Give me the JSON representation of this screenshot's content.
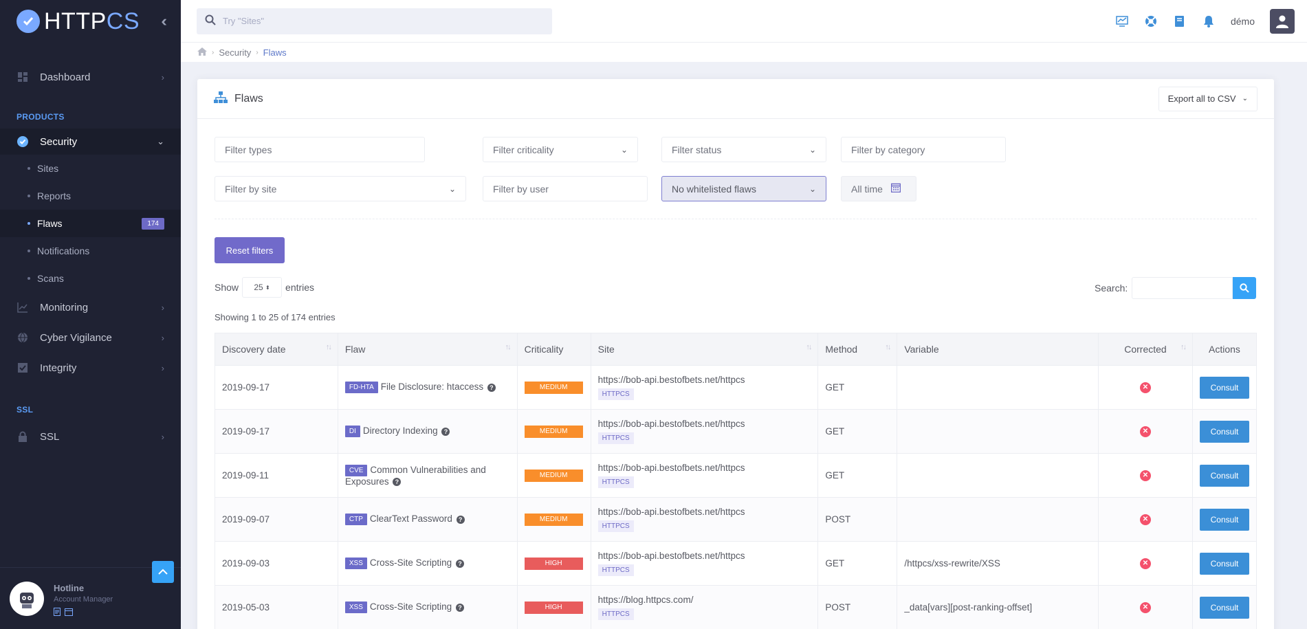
{
  "brand": {
    "name_part1": "HTTP",
    "name_part2": "CS"
  },
  "sidebar": {
    "dashboard": "Dashboard",
    "section_products": "PRODUCTS",
    "security": "Security",
    "sub": [
      {
        "label": "Sites"
      },
      {
        "label": "Reports"
      },
      {
        "label": "Flaws",
        "badge": "174"
      },
      {
        "label": "Notifications"
      },
      {
        "label": "Scans"
      }
    ],
    "monitoring": "Monitoring",
    "cyber_vigilance": "Cyber Vigilance",
    "integrity": "Integrity",
    "section_ssl": "SSL",
    "ssl": "SSL",
    "hotline": "Hotline",
    "account_manager": "Account Manager"
  },
  "header": {
    "search_placeholder": "Try \"Sites\"",
    "username": "démo"
  },
  "breadcrumb": {
    "security": "Security",
    "flaws": "Flaws"
  },
  "card": {
    "title": "Flaws",
    "export": "Export all to CSV"
  },
  "filters": {
    "types": "Filter types",
    "criticality": "Filter criticality",
    "status": "Filter status",
    "category": "Filter by category",
    "site": "Filter by site",
    "user": "Filter by user",
    "whitelist": "No whitelisted flaws",
    "date": "All time",
    "reset": "Reset filters"
  },
  "table_controls": {
    "show": "Show",
    "length": "25",
    "entries": "entries",
    "search_label": "Search:",
    "showing": "Showing 1 to 25 of 174 entries"
  },
  "columns": [
    "Discovery date",
    "Flaw",
    "Criticality",
    "Site",
    "Method",
    "Variable",
    "Corrected",
    "Actions"
  ],
  "rows": [
    {
      "date": "2019-09-17",
      "code": "FD-HTA",
      "flaw": "File Disclosure: htaccess",
      "criticality": "MEDIUM",
      "site": "https://bob-api.bestofbets.net/httpcs",
      "tag": "HTTPCS",
      "method": "GET",
      "variable": "",
      "action": "Consult"
    },
    {
      "date": "2019-09-17",
      "code": "DI",
      "flaw": "Directory Indexing",
      "criticality": "MEDIUM",
      "site": "https://bob-api.bestofbets.net/httpcs",
      "tag": "HTTPCS",
      "method": "GET",
      "variable": "",
      "action": "Consult"
    },
    {
      "date": "2019-09-11",
      "code": "CVE",
      "flaw": "Common Vulnerabilities and Exposures",
      "criticality": "MEDIUM",
      "site": "https://bob-api.bestofbets.net/httpcs",
      "tag": "HTTPCS",
      "method": "GET",
      "variable": "",
      "action": "Consult"
    },
    {
      "date": "2019-09-07",
      "code": "CTP",
      "flaw": "ClearText Password",
      "criticality": "MEDIUM",
      "site": "https://bob-api.bestofbets.net/httpcs",
      "tag": "HTTPCS",
      "method": "POST",
      "variable": "",
      "action": "Consult"
    },
    {
      "date": "2019-09-03",
      "code": "XSS",
      "flaw": "Cross-Site Scripting",
      "criticality": "HIGH",
      "site": "https://bob-api.bestofbets.net/httpcs",
      "tag": "HTTPCS",
      "method": "GET",
      "variable": "/httpcs/xss-rewrite/XSS",
      "action": "Consult"
    },
    {
      "date": "2019-05-03",
      "code": "XSS",
      "flaw": "Cross-Site Scripting",
      "criticality": "HIGH",
      "site": "https://blog.httpcs.com/",
      "tag": "HTTPCS",
      "method": "POST",
      "variable": "_data[vars][post-ranking-offset]",
      "action": "Consult"
    }
  ],
  "colors": {
    "accent": "#716aca",
    "brand": "#7aa9ff",
    "medium": "#f98e2b",
    "high": "#e85c5c",
    "consult": "#3b8fd7"
  }
}
